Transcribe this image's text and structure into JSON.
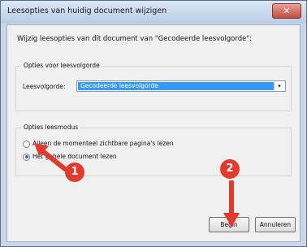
{
  "window": {
    "title": "Leesopties van huidig document wijzigen",
    "close_glyph": "✕"
  },
  "dialog": {
    "prompt": "Wijzig leesopties van dit document van \"Gecodeerde leesvolgorde\":",
    "reading_order_group": {
      "legend": "Opties voor leesvolgorde",
      "field_label": "Leesvolgorde:",
      "selected_value": "Gecodeerde leesvolgorde",
      "dropdown_glyph": "▾"
    },
    "reading_mode_group": {
      "legend": "Opties leesmodus",
      "options": [
        {
          "label": "Alleen de momenteel zichtbare pagina's lezen",
          "selected": false
        },
        {
          "label": "Het gehele document lezen",
          "selected": true
        }
      ]
    },
    "buttons": {
      "start": "Begin",
      "cancel": "Annuleren"
    }
  },
  "annotations": {
    "step1": "1",
    "step2": "2",
    "color": "#e23a2d"
  }
}
